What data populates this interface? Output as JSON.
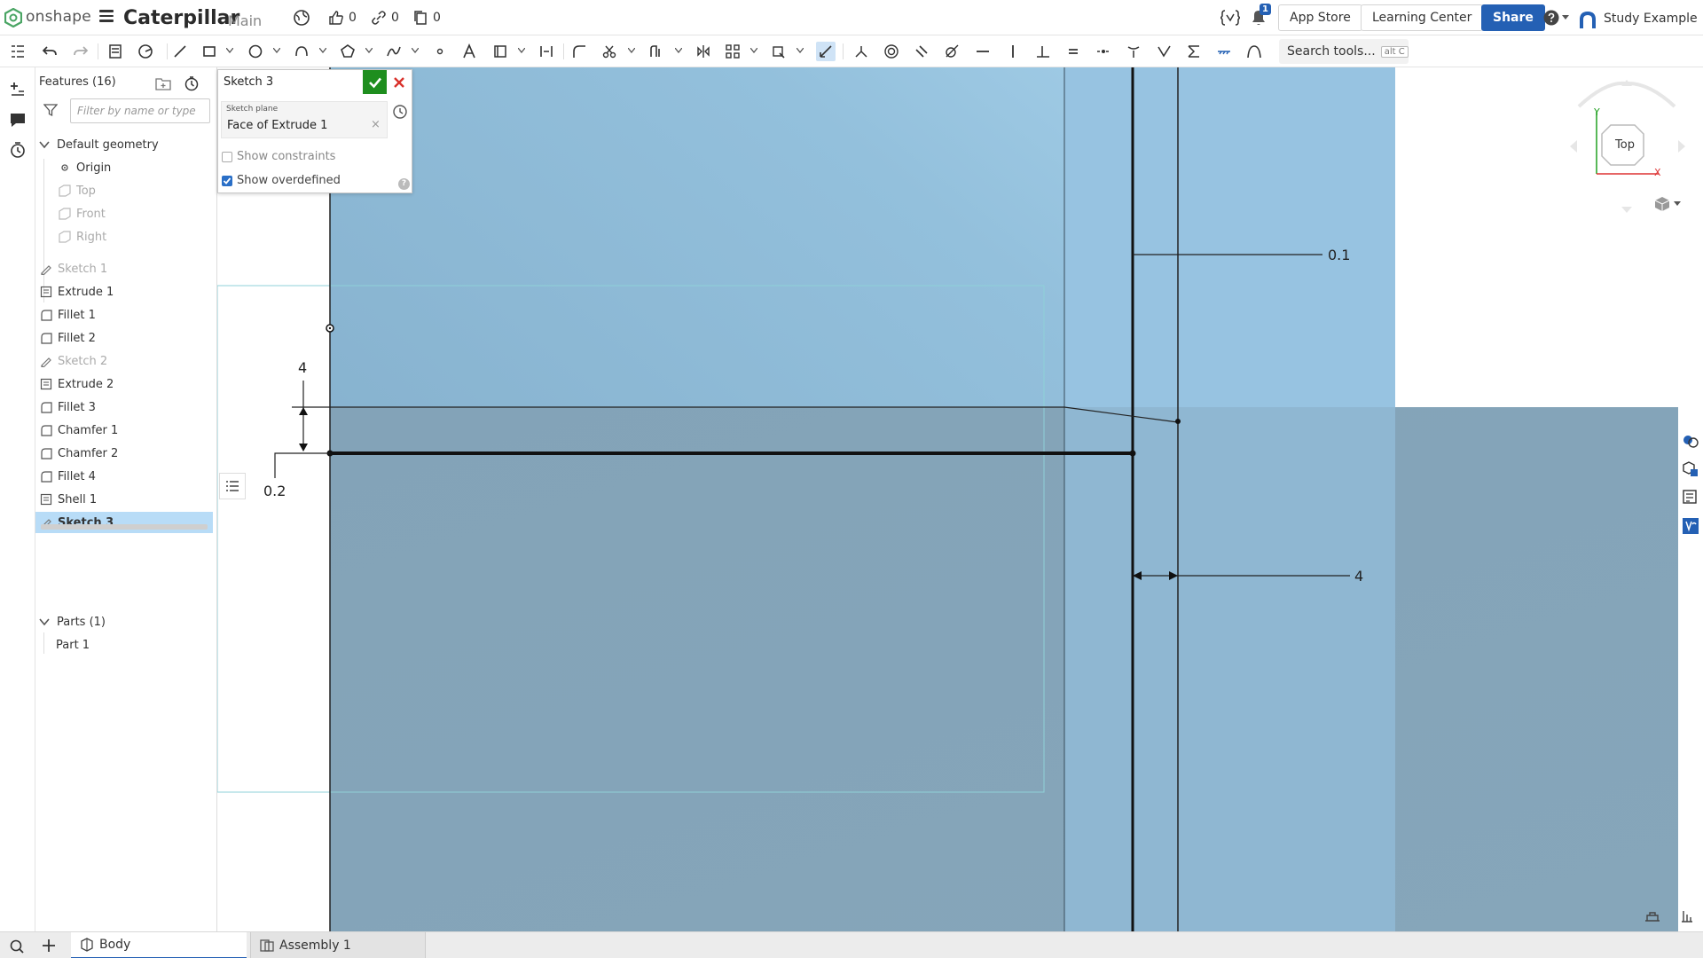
{
  "app": {
    "logo_text": "onshape",
    "document_title": "Caterpillar",
    "branch": "Main",
    "likes": "0",
    "links": "0",
    "copies": "0",
    "notifications_badge": "1",
    "app_store": "App Store",
    "learning_center": "Learning Center",
    "share": "Share",
    "user": "Study Example"
  },
  "toolbar": {
    "search_tools": "Search tools...",
    "search_shortcut": "alt C"
  },
  "features": {
    "header": "Features (16)",
    "filter_placeholder": "Filter by name or type",
    "default_geometry": "Default geometry",
    "origin": "Origin",
    "top": "Top",
    "front": "Front",
    "right": "Right",
    "items": [
      {
        "label": "Sketch 1",
        "kind": "sketch",
        "dim": true
      },
      {
        "label": "Extrude 1",
        "kind": "extrude",
        "dim": false
      },
      {
        "label": "Fillet 1",
        "kind": "fillet",
        "dim": false
      },
      {
        "label": "Fillet 2",
        "kind": "fillet",
        "dim": false
      },
      {
        "label": "Sketch 2",
        "kind": "sketch",
        "dim": true
      },
      {
        "label": "Extrude 2",
        "kind": "extrude",
        "dim": false
      },
      {
        "label": "Fillet 3",
        "kind": "fillet",
        "dim": false
      },
      {
        "label": "Chamfer 1",
        "kind": "fillet",
        "dim": false
      },
      {
        "label": "Chamfer 2",
        "kind": "fillet",
        "dim": false
      },
      {
        "label": "Fillet 4",
        "kind": "fillet",
        "dim": false
      },
      {
        "label": "Shell 1",
        "kind": "extrude",
        "dim": false
      },
      {
        "label": "Sketch 3",
        "kind": "sketch",
        "dim": false,
        "selected": true
      }
    ],
    "parts_header": "Parts (1)",
    "part": "Part 1"
  },
  "dialog": {
    "title": "Sketch 3",
    "plane_label": "Sketch plane",
    "plane_value": "Face of Extrude 1",
    "clear": "×",
    "show_constraints": "Show constraints",
    "show_overdefined": "Show overdefined",
    "help": "?"
  },
  "canvas": {
    "dim_01": "0.1",
    "dim_4_vertical": "4",
    "dim_02": "0.2",
    "dim_4_horizontal": "4"
  },
  "viewcube": {
    "face": "Top",
    "axis_y": "Y",
    "axis_x": "X"
  },
  "tabs": [
    {
      "label": "Body",
      "active": true
    },
    {
      "label": "Assembly 1",
      "active": false
    }
  ],
  "colors": {
    "accent": "#2460b4",
    "selected_row": "#b8dcf7",
    "ok_green": "#1e8e1e",
    "close_red": "#d9312b",
    "part_blue": "#98c3df",
    "part_dark": "#85a5b9"
  }
}
